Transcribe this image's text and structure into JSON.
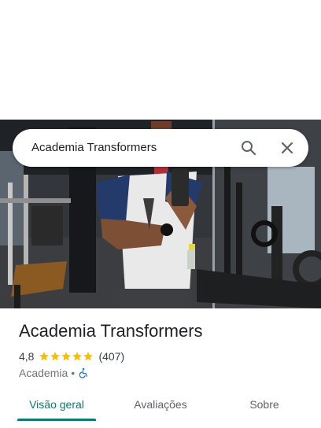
{
  "search": {
    "query": "Academia Transformers"
  },
  "place": {
    "name": "Academia Transformers",
    "rating": "4,8",
    "stars": 5,
    "review_count": "(407)",
    "category": "Academia",
    "separator": "•"
  },
  "tabs": [
    {
      "label": "Visão geral",
      "active": true
    },
    {
      "label": "Avaliações",
      "active": false
    },
    {
      "label": "Sobre",
      "active": false
    }
  ],
  "colors": {
    "accent": "#0b7a6f",
    "star": "#fbbc04",
    "accessibility": "#1a73e8"
  },
  "icons": {
    "search": "search-icon",
    "close": "close-icon",
    "wheelchair": "wheelchair-icon",
    "star": "star-icon"
  }
}
